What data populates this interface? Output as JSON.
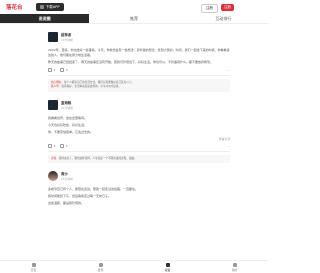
{
  "topbar": {
    "logo": "落花台",
    "download_label": "下载APP",
    "login_label": "注册",
    "register_label": "注册"
  },
  "tabs": [
    {
      "label": "说说圈"
    },
    {
      "label": "推荐"
    },
    {
      "label": "互动排行"
    }
  ],
  "posts": [
    {
      "username": "超神者",
      "time": "19分钟前",
      "paragraphs": [
        "2022年，更多，你也坐好一些事情，今天，你依然会有一些想法，另外我的想法，找到大家的，时间，我们一起坐下来的时候，你看看身边的人，他们都在努力地生活着。",
        "昨天的故事已经结束了，明天的故事还没有开始，愿我们珍惜当下，好好生活。你也可以，不管遇到什么，都不要放弃希望。"
      ],
      "likes": "4",
      "comments_count": "5",
      "comments": [
        {
          "name": "热心网友",
          "text": "每个人都有自己的生活方式，我们只需要做好自己就可以了。"
        },
        {
          "name": "路人甲",
          "text": "说得真好，生活本来就是这样的，平平淡淡才是真。"
        }
      ]
    },
    {
      "username": "蓝海鲸",
      "time": "21分钟前",
      "paragraphs": [
        "我看看世界，坐在这里等待。",
        "今天也好好吃饭，好好生活。",
        "你，不要害怕孤单，它会过去的。"
      ],
      "likes": "3",
      "comments_count": "1",
      "view_more": "查看全部",
      "comments": [
        {
          "name": "过客",
          "text": "说得太好了，我也这样觉得，人生就是一个不断前进的过程，加油。"
        }
      ]
    },
    {
      "username": "青沙",
      "time": "24分钟前",
      "paragraphs": [
        "多希望自己有个人，能陪在身边，帮我一起走过这段路，一直都在。",
        "我时间能找下午，然后等我走过每一天的日子。",
        "这些温暖，都是我珍惜的。"
      ]
    }
  ],
  "bottom_nav": [
    {
      "label": "首页",
      "icon": "home-icon"
    },
    {
      "label": "发现",
      "icon": "discover-icon"
    },
    {
      "label": "说说",
      "icon": "post-icon"
    },
    {
      "label": "我的",
      "icon": "user-icon"
    }
  ]
}
